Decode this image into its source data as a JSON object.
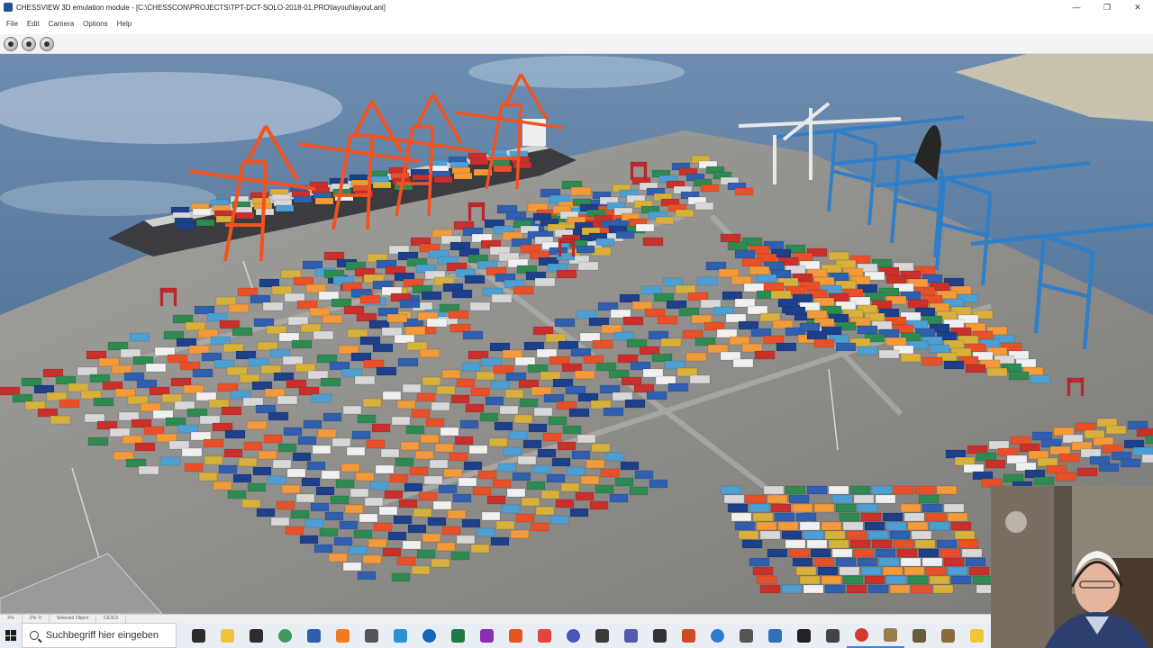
{
  "window": {
    "title": "CHESSVIEW 3D emulation module - [C:\\CHESSCON\\PROJECTS\\TPT-DCT-SOLO-2018-01.PRO\\layout\\layout.ani]",
    "controls": [
      "—",
      "❐",
      "✕"
    ]
  },
  "menu": {
    "items": [
      "File",
      "Edit",
      "Camera",
      "Options",
      "Help"
    ]
  },
  "toolbar": {
    "buttons": [
      "play-icon",
      "camera-icon",
      "clock-icon"
    ]
  },
  "colors": {
    "water": "#4b6f95",
    "quay": "#8e8d8a",
    "sts_crane_orange": "#f2521e",
    "sts_crane_blue": "#2f7fc8",
    "container_palette": [
      "#e8502a",
      "#2f5fae",
      "#2f8a52",
      "#d8d8d8",
      "#d7b13c",
      "#c9302c",
      "#4d9fd3",
      "#f39a3b",
      "#f0f0f0",
      "#1e3f8a"
    ]
  },
  "statusbar": {
    "cells": [
      "X%",
      "Z%: 0",
      "Selected Object",
      "CE3C0"
    ]
  },
  "taskbar": {
    "search_placeholder": "Suchbegriff hier eingeben",
    "icons": [
      {
        "name": "task-view-icon",
        "color": "#2b2b2b"
      },
      {
        "name": "file-explorer-icon",
        "color": "#f2c13b"
      },
      {
        "name": "store-icon",
        "color": "#2d2d2d"
      },
      {
        "name": "globe-icon",
        "color": "#3a9b5c"
      },
      {
        "name": "word-icon",
        "color": "#2b5fae"
      },
      {
        "name": "firefox-icon",
        "color": "#f07b22"
      },
      {
        "name": "notes-icon",
        "color": "#555555"
      },
      {
        "name": "edge-icon",
        "color": "#2a8fd4"
      },
      {
        "name": "outlook-icon",
        "color": "#1765b8"
      },
      {
        "name": "excel-icon",
        "color": "#1d7a45"
      },
      {
        "name": "media-icon",
        "color": "#8b2db5"
      },
      {
        "name": "firefox-alt-icon",
        "color": "#e7531f"
      },
      {
        "name": "chrome-icon",
        "color": "#e2453c"
      },
      {
        "name": "teams-icon",
        "color": "#4b53bc"
      },
      {
        "name": "camera-app-icon",
        "color": "#3a3a3a"
      },
      {
        "name": "teams-alt-icon",
        "color": "#5558af"
      },
      {
        "name": "settings-wheel-icon",
        "color": "#333333"
      },
      {
        "name": "powerpoint-icon",
        "color": "#d04a26"
      },
      {
        "name": "vscode-icon",
        "color": "#2c7bd0"
      },
      {
        "name": "app-box-icon",
        "color": "#555555"
      },
      {
        "name": "window-icon",
        "color": "#2e6fb8"
      },
      {
        "name": "terminal-icon",
        "color": "#222222"
      },
      {
        "name": "clock-app-icon",
        "color": "#444444"
      },
      {
        "name": "red-app-icon",
        "color": "#d63a2c"
      },
      {
        "name": "chessview-icon",
        "color": "#9a7b4a"
      },
      {
        "name": "webcam-app-icon",
        "color": "#6a5b3e"
      },
      {
        "name": "user-app-icon",
        "color": "#8a6d3a"
      },
      {
        "name": "tray-icon",
        "color": "#f4c534"
      }
    ]
  }
}
